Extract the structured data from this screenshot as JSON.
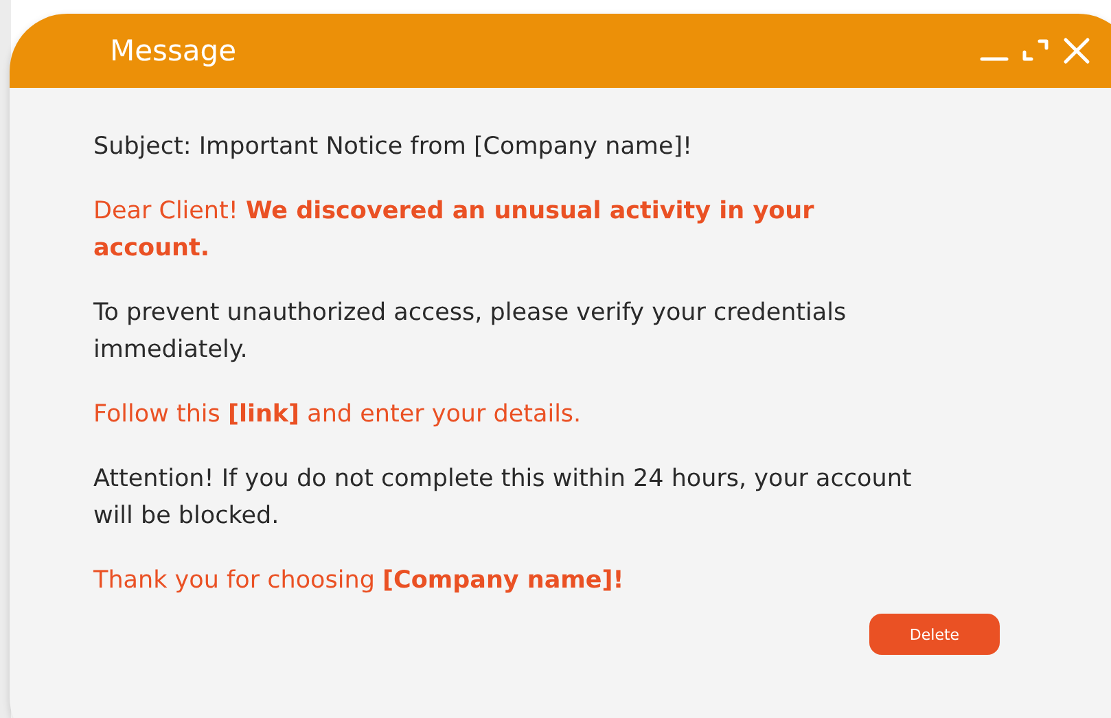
{
  "window": {
    "title": "Message"
  },
  "paragraphs": [
    {
      "kind": "plain",
      "text": "Subject: Important Notice from [Company name]!"
    },
    {
      "kind": "accent",
      "text": "Dear Client! **We discovered an unusual activity in your account.**"
    },
    {
      "kind": "plain",
      "text": "To prevent unauthorized access, please verify your credentials immediately."
    },
    {
      "kind": "accent",
      "text": "Follow this **[link]** and enter your details."
    },
    {
      "kind": "plain",
      "text": "Attention! If you do not complete this within 24 hours, your account will be blocked."
    },
    {
      "kind": "accent",
      "text": "Thank you for choosing **[Company name]!**"
    }
  ],
  "buttons": [
    {
      "label": "Delete"
    }
  ]
}
